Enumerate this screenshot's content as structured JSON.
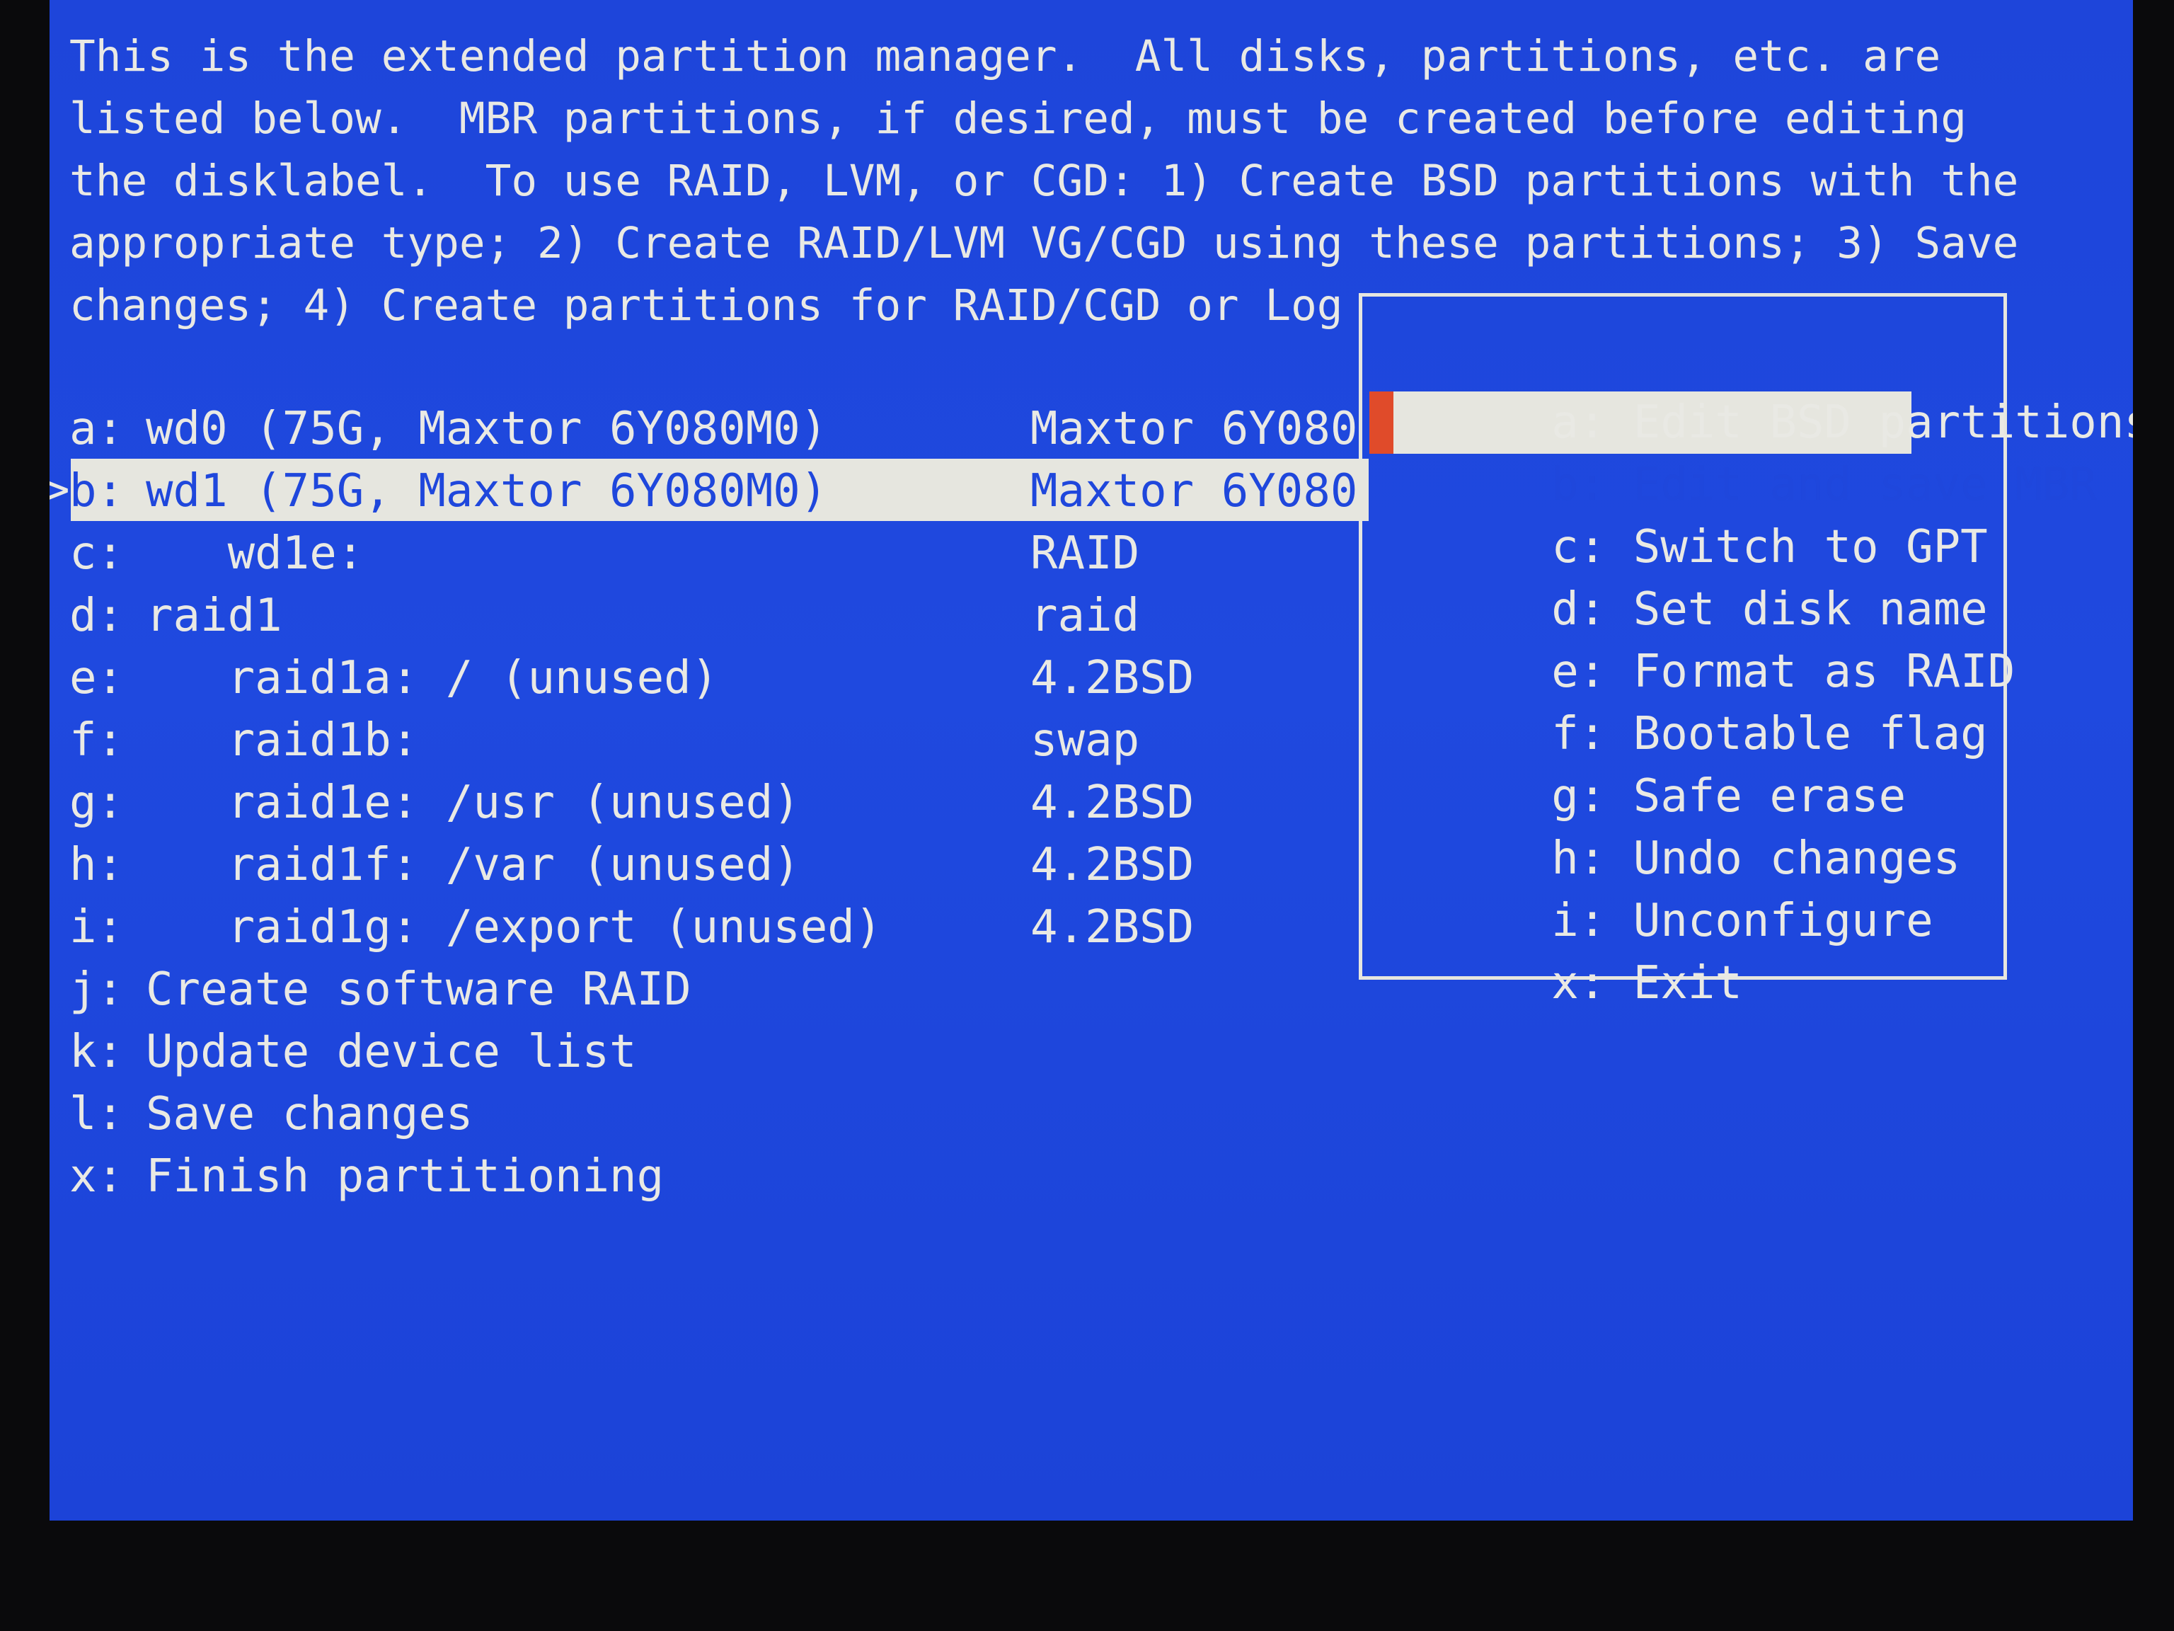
{
  "intro_lines": [
    "This is the extended partition manager.  All disks, partitions, etc. are",
    "listed below.  MBR partitions, if desired, must be created before editing",
    "the disklabel.  To use RAID, LVM, or CGD: 1) Create BSD partitions with the",
    "appropriate type; 2) Create RAID/LVM VG/CGD using these partitions; 3) Save",
    "changes; 4) Create partitions for RAID/CGD or Log"
  ],
  "devices": [
    {
      "key": "a:",
      "name": "wd0 (75G, Maxtor 6Y080M0)",
      "type": "Maxtor 6Y080",
      "selected": false
    },
    {
      "key": "b:",
      "name": "wd1 (75G, Maxtor 6Y080M0)",
      "type": "Maxtor 6Y080",
      "selected": true
    },
    {
      "key": "c:",
      "name": "   wd1e:",
      "type": "RAID",
      "selected": false
    },
    {
      "key": "d:",
      "name": "raid1",
      "type": "raid",
      "selected": false
    },
    {
      "key": "e:",
      "name": "   raid1a: / (unused)",
      "type": "4.2BSD",
      "selected": false
    },
    {
      "key": "f:",
      "name": "   raid1b:",
      "type": "swap",
      "selected": false
    },
    {
      "key": "g:",
      "name": "   raid1e: /usr (unused)",
      "type": "4.2BSD",
      "selected": false
    },
    {
      "key": "h:",
      "name": "   raid1f: /var (unused)",
      "type": "4.2BSD",
      "selected": false
    },
    {
      "key": "i:",
      "name": "   raid1g: /export (unused)",
      "type": "4.2BSD",
      "selected": false
    }
  ],
  "actions": [
    {
      "key": "j:",
      "label": "Create software RAID"
    },
    {
      "key": "k:",
      "label": "Update device list"
    },
    {
      "key": "l:",
      "label": "Save changes"
    },
    {
      "key": "x:",
      "label": "Finish partitioning"
    }
  ],
  "selection_marker": ">",
  "popup_menu": [
    {
      "key": "a:",
      "label": "Edit BSD partitions",
      "selected": false
    },
    {
      "key": "b:",
      "label": "Edit and save MBR",
      "selected": true
    },
    {
      "key": "c:",
      "label": "Switch to GPT",
      "selected": false
    },
    {
      "key": "d:",
      "label": "Set disk name",
      "selected": false
    },
    {
      "key": "e:",
      "label": "Format as RAID",
      "selected": false
    },
    {
      "key": "f:",
      "label": "Bootable flag",
      "selected": false
    },
    {
      "key": "g:",
      "label": "Safe erase",
      "selected": false
    },
    {
      "key": "h:",
      "label": "Undo changes",
      "selected": false
    },
    {
      "key": "i:",
      "label": "Unconfigure",
      "selected": false
    },
    {
      "key": "x:",
      "label": "Exit",
      "selected": false
    }
  ],
  "colors": {
    "background": "#1f47dc",
    "text": "#e9e9e4",
    "highlight": "#e6e6df",
    "cursor": "#e04b2a"
  }
}
